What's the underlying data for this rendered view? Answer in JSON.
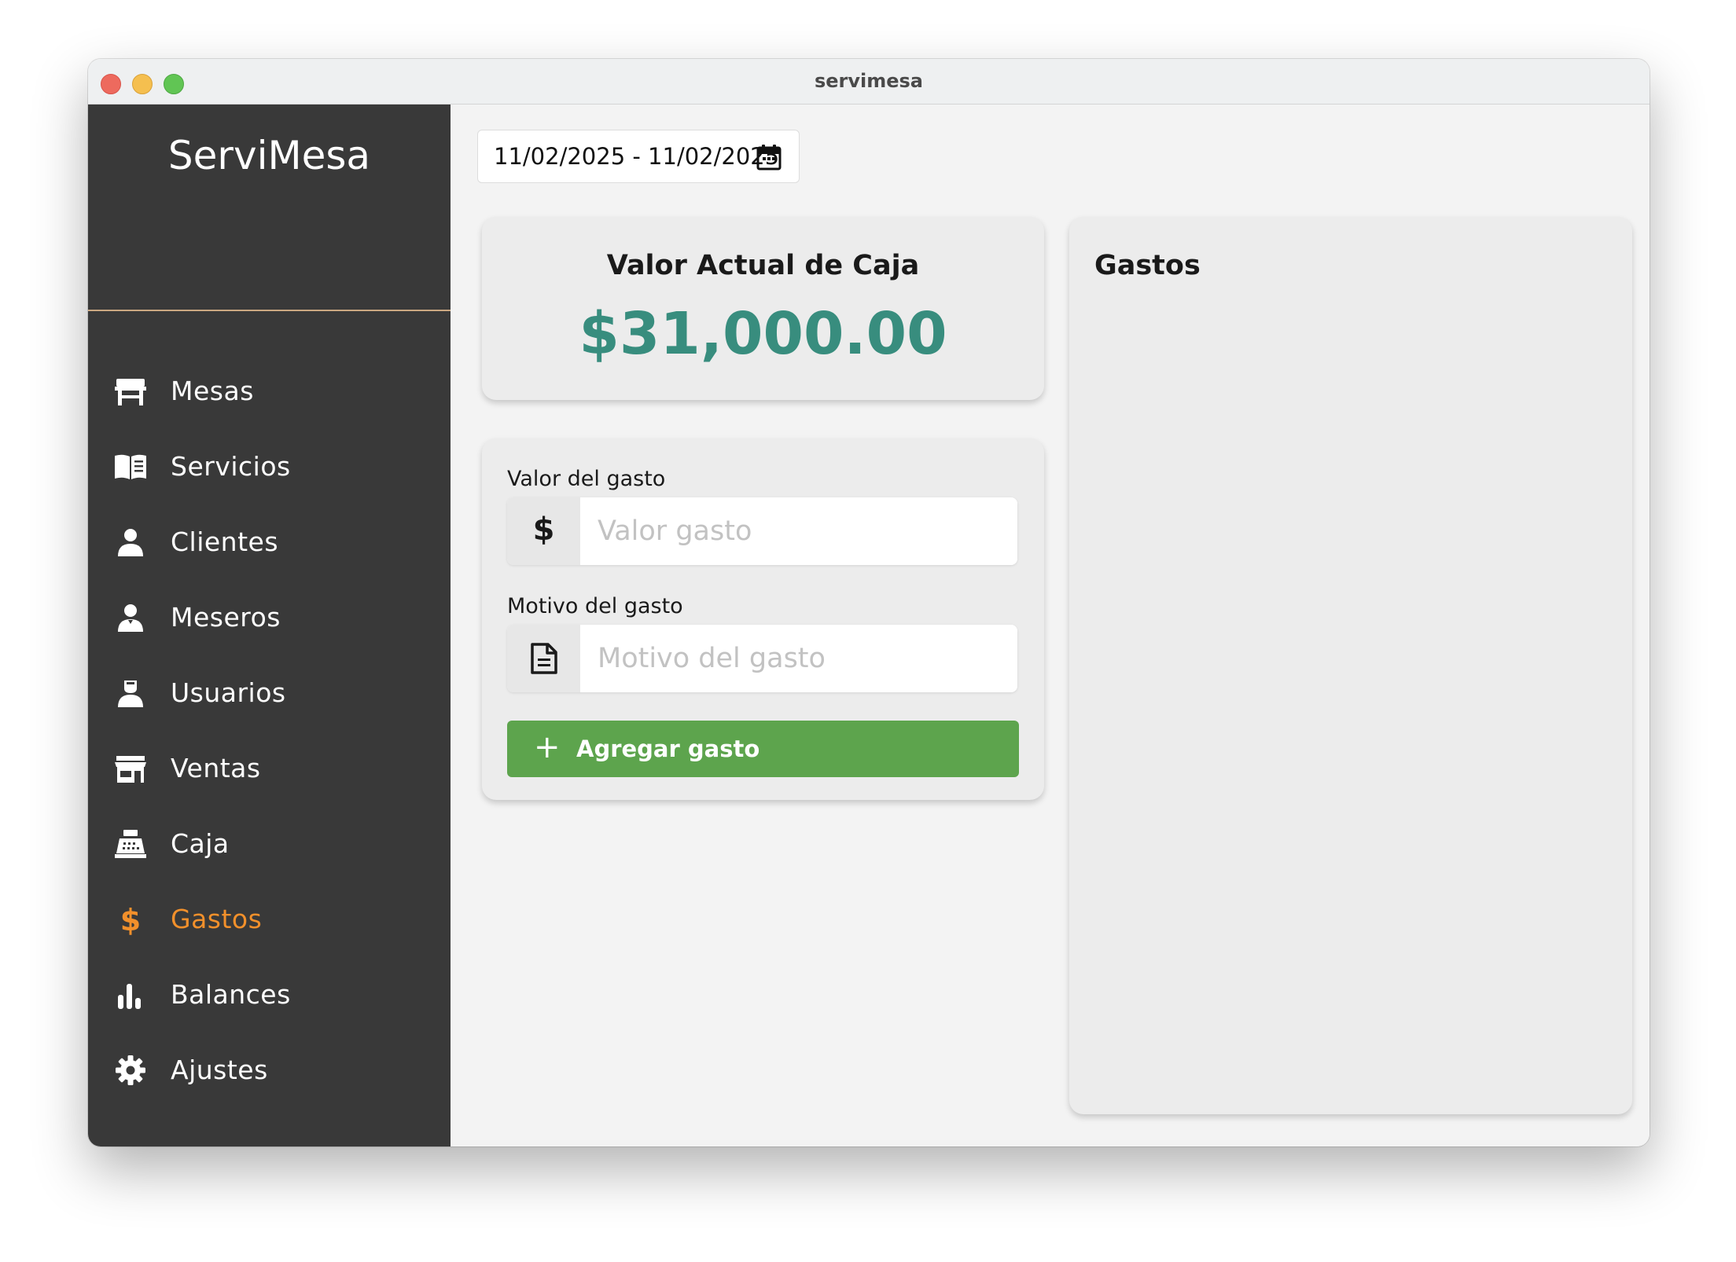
{
  "window": {
    "title": "servimesa"
  },
  "sidebar": {
    "brand": "ServiMesa",
    "active_color": "#f2902b",
    "items": [
      {
        "label": "Mesas",
        "icon": "table-icon"
      },
      {
        "label": "Servicios",
        "icon": "open-book-icon"
      },
      {
        "label": "Clientes",
        "icon": "person-icon"
      },
      {
        "label": "Meseros",
        "icon": "waiter-icon"
      },
      {
        "label": "Usuarios",
        "icon": "user-icon"
      },
      {
        "label": "Ventas",
        "icon": "store-icon"
      },
      {
        "label": "Caja",
        "icon": "cash-register-icon"
      },
      {
        "label": "Gastos",
        "icon": "dollar-icon",
        "active": true
      },
      {
        "label": "Balances",
        "icon": "bar-chart-icon"
      },
      {
        "label": "Ajustes",
        "icon": "gear-icon"
      }
    ]
  },
  "main": {
    "date_range": "11/02/2025 - 11/02/2025",
    "cash_card": {
      "title": "Valor Actual de Caja",
      "value": "$31,000.00",
      "value_color": "#388d7e"
    },
    "form": {
      "amount_label": "Valor del gasto",
      "amount_addon": "$",
      "amount_placeholder": "Valor gasto",
      "amount_value": "",
      "reason_label": "Motivo del gasto",
      "reason_placeholder": "Motivo del gasto",
      "reason_value": "",
      "add_button_icon": "+",
      "add_button_label": "Agregar gasto",
      "add_button_color": "#5da44d"
    },
    "expenses": {
      "title": "Gastos",
      "items": []
    }
  }
}
